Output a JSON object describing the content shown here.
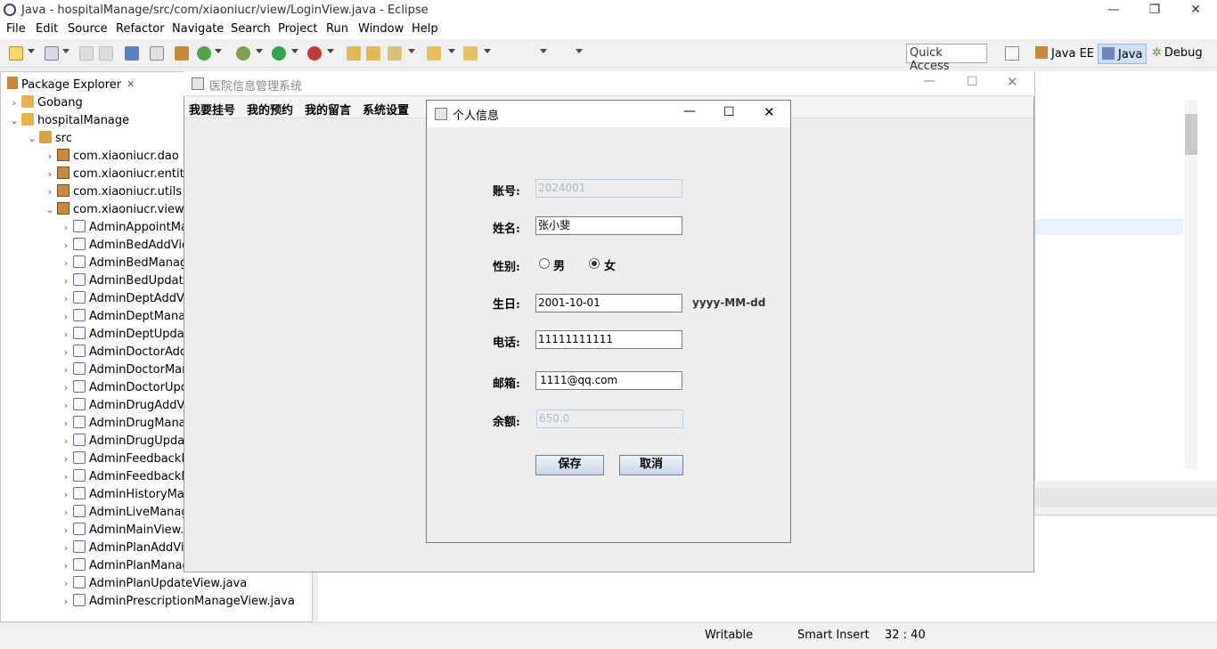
{
  "window": {
    "title": "Java - hospitalManage/src/com/xiaoniucr/view/LoginView.java - Eclipse"
  },
  "menubar": [
    "File",
    "Edit",
    "Source",
    "Refactor",
    "Navigate",
    "Search",
    "Project",
    "Run",
    "Window",
    "Help"
  ],
  "toolbar": {
    "quick_access_placeholder": "Quick Access",
    "perspectives": [
      "Java EE",
      "Java",
      "Debug"
    ]
  },
  "package_explorer": {
    "tab_label": "Package Explorer",
    "tree": [
      {
        "label": "Gobang",
        "level": 0,
        "icon": "project-icon",
        "expanded": false
      },
      {
        "label": "hospitalManage",
        "level": 0,
        "icon": "project-icon",
        "expanded": true
      },
      {
        "label": "src",
        "level": 1,
        "icon": "source-folder-icon",
        "expanded": true
      },
      {
        "label": "com.xiaoniucr.dao",
        "level": 2,
        "icon": "package-icon",
        "expanded": false
      },
      {
        "label": "com.xiaoniucr.entity",
        "level": 2,
        "icon": "package-icon",
        "expanded": false
      },
      {
        "label": "com.xiaoniucr.utils",
        "level": 2,
        "icon": "package-icon",
        "expanded": false
      },
      {
        "label": "com.xiaoniucr.view",
        "level": 2,
        "icon": "package-icon",
        "expanded": true
      },
      {
        "label": "AdminAppointMa",
        "level": 3,
        "icon": "java-file-icon"
      },
      {
        "label": "AdminBedAddVie",
        "level": 3,
        "icon": "java-file-icon"
      },
      {
        "label": "AdminBedManag",
        "level": 3,
        "icon": "java-file-icon"
      },
      {
        "label": "AdminBedUpdate",
        "level": 3,
        "icon": "java-file-icon"
      },
      {
        "label": "AdminDeptAddVi",
        "level": 3,
        "icon": "java-file-icon"
      },
      {
        "label": "AdminDeptManag",
        "level": 3,
        "icon": "java-file-icon"
      },
      {
        "label": "AdminDeptUpdat",
        "level": 3,
        "icon": "java-file-icon"
      },
      {
        "label": "AdminDoctorAdd",
        "level": 3,
        "icon": "java-file-icon"
      },
      {
        "label": "AdminDoctorMar",
        "level": 3,
        "icon": "java-file-icon"
      },
      {
        "label": "AdminDoctorUpd",
        "level": 3,
        "icon": "java-file-icon"
      },
      {
        "label": "AdminDrugAddVi",
        "level": 3,
        "icon": "java-file-icon"
      },
      {
        "label": "AdminDrugMana",
        "level": 3,
        "icon": "java-file-icon"
      },
      {
        "label": "AdminDrugUpdat",
        "level": 3,
        "icon": "java-file-icon"
      },
      {
        "label": "AdminFeedbackM",
        "level": 3,
        "icon": "java-file-icon"
      },
      {
        "label": "AdminFeedbackR",
        "level": 3,
        "icon": "java-file-icon"
      },
      {
        "label": "AdminHistoryMar",
        "level": 3,
        "icon": "java-file-icon"
      },
      {
        "label": "AdminLiveManag",
        "level": 3,
        "icon": "java-file-icon"
      },
      {
        "label": "AdminMainView.j",
        "level": 3,
        "icon": "java-file-icon"
      },
      {
        "label": "AdminPlanAddVie",
        "level": 3,
        "icon": "java-file-icon"
      },
      {
        "label": "AdminPlanManag",
        "level": 3,
        "icon": "java-file-icon"
      },
      {
        "label": "AdminPlanUpdateView.java",
        "level": 3,
        "icon": "java-file-icon"
      },
      {
        "label": "AdminPrescriptionManageView.java",
        "level": 3,
        "icon": "java-file-icon"
      }
    ]
  },
  "statusbar": {
    "writable": "Writable",
    "insert_mode": "Smart Insert",
    "position": "32 : 40"
  },
  "main_window": {
    "title": "医院信息管理系统",
    "menus": [
      "我要挂号",
      "我的预约",
      "我的留言",
      "系统设置"
    ]
  },
  "dialog": {
    "title": "个人信息",
    "labels": {
      "account": "账号:",
      "name": "姓名:",
      "gender": "性别:",
      "birthday": "生日:",
      "phone": "电话:",
      "email": "邮箱:",
      "balance": "余额:"
    },
    "values": {
      "account": "2024001",
      "name": "张小斐",
      "birthday": "2001-10-01",
      "phone": "11111111111",
      "email": "1111@qq.com",
      "balance": "650.0"
    },
    "gender_options": [
      "男",
      "女"
    ],
    "gender_selected": "女",
    "date_format_hint": "yyyy-MM-dd",
    "buttons": {
      "save": "保存",
      "cancel": "取消"
    }
  }
}
